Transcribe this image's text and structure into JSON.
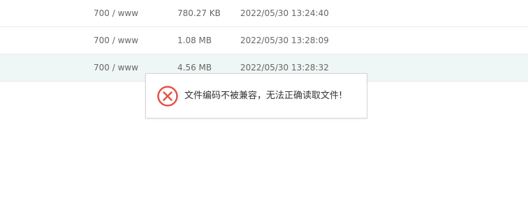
{
  "file_rows": [
    {
      "permission": "700 / www",
      "size": "780.27 KB",
      "modified": "2022/05/30 13:24:40"
    },
    {
      "permission": "700 / www",
      "size": "1.08 MB",
      "modified": "2022/05/30 13:28:09"
    },
    {
      "permission": "700 / www",
      "size": "4.56 MB",
      "modified": "2022/05/30 13:28:32"
    }
  ],
  "error_toast": {
    "icon": "error-x-circle-icon",
    "message": "文件编码不被兼容，无法正确读取文件!"
  },
  "colors": {
    "error_red": "#e3524a",
    "row_highlight": "#eef7f5"
  }
}
